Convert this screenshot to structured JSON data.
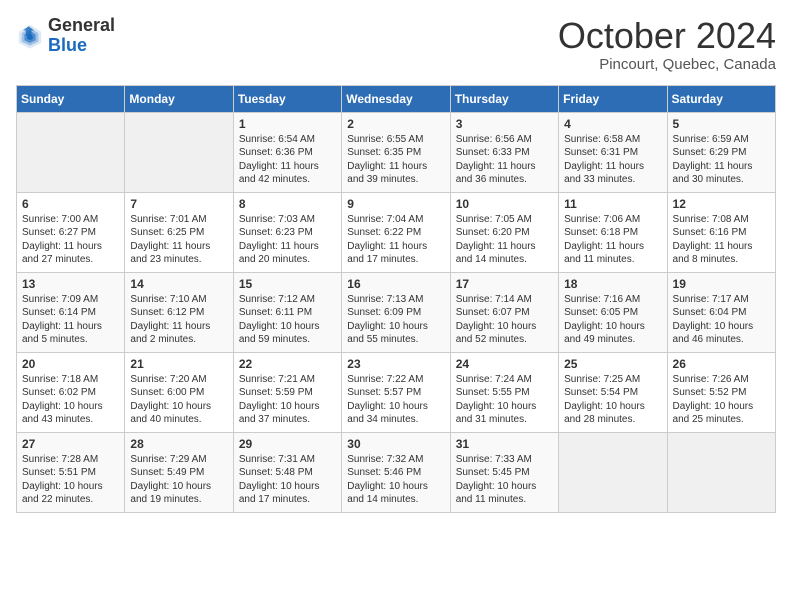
{
  "header": {
    "logo_line1": "General",
    "logo_line2": "Blue",
    "month": "October 2024",
    "location": "Pincourt, Quebec, Canada"
  },
  "weekdays": [
    "Sunday",
    "Monday",
    "Tuesday",
    "Wednesday",
    "Thursday",
    "Friday",
    "Saturday"
  ],
  "weeks": [
    [
      {
        "day": "",
        "sunrise": "",
        "sunset": "",
        "daylight": ""
      },
      {
        "day": "",
        "sunrise": "",
        "sunset": "",
        "daylight": ""
      },
      {
        "day": "1",
        "sunrise": "Sunrise: 6:54 AM",
        "sunset": "Sunset: 6:36 PM",
        "daylight": "Daylight: 11 hours and 42 minutes."
      },
      {
        "day": "2",
        "sunrise": "Sunrise: 6:55 AM",
        "sunset": "Sunset: 6:35 PM",
        "daylight": "Daylight: 11 hours and 39 minutes."
      },
      {
        "day": "3",
        "sunrise": "Sunrise: 6:56 AM",
        "sunset": "Sunset: 6:33 PM",
        "daylight": "Daylight: 11 hours and 36 minutes."
      },
      {
        "day": "4",
        "sunrise": "Sunrise: 6:58 AM",
        "sunset": "Sunset: 6:31 PM",
        "daylight": "Daylight: 11 hours and 33 minutes."
      },
      {
        "day": "5",
        "sunrise": "Sunrise: 6:59 AM",
        "sunset": "Sunset: 6:29 PM",
        "daylight": "Daylight: 11 hours and 30 minutes."
      }
    ],
    [
      {
        "day": "6",
        "sunrise": "Sunrise: 7:00 AM",
        "sunset": "Sunset: 6:27 PM",
        "daylight": "Daylight: 11 hours and 27 minutes."
      },
      {
        "day": "7",
        "sunrise": "Sunrise: 7:01 AM",
        "sunset": "Sunset: 6:25 PM",
        "daylight": "Daylight: 11 hours and 23 minutes."
      },
      {
        "day": "8",
        "sunrise": "Sunrise: 7:03 AM",
        "sunset": "Sunset: 6:23 PM",
        "daylight": "Daylight: 11 hours and 20 minutes."
      },
      {
        "day": "9",
        "sunrise": "Sunrise: 7:04 AM",
        "sunset": "Sunset: 6:22 PM",
        "daylight": "Daylight: 11 hours and 17 minutes."
      },
      {
        "day": "10",
        "sunrise": "Sunrise: 7:05 AM",
        "sunset": "Sunset: 6:20 PM",
        "daylight": "Daylight: 11 hours and 14 minutes."
      },
      {
        "day": "11",
        "sunrise": "Sunrise: 7:06 AM",
        "sunset": "Sunset: 6:18 PM",
        "daylight": "Daylight: 11 hours and 11 minutes."
      },
      {
        "day": "12",
        "sunrise": "Sunrise: 7:08 AM",
        "sunset": "Sunset: 6:16 PM",
        "daylight": "Daylight: 11 hours and 8 minutes."
      }
    ],
    [
      {
        "day": "13",
        "sunrise": "Sunrise: 7:09 AM",
        "sunset": "Sunset: 6:14 PM",
        "daylight": "Daylight: 11 hours and 5 minutes."
      },
      {
        "day": "14",
        "sunrise": "Sunrise: 7:10 AM",
        "sunset": "Sunset: 6:12 PM",
        "daylight": "Daylight: 11 hours and 2 minutes."
      },
      {
        "day": "15",
        "sunrise": "Sunrise: 7:12 AM",
        "sunset": "Sunset: 6:11 PM",
        "daylight": "Daylight: 10 hours and 59 minutes."
      },
      {
        "day": "16",
        "sunrise": "Sunrise: 7:13 AM",
        "sunset": "Sunset: 6:09 PM",
        "daylight": "Daylight: 10 hours and 55 minutes."
      },
      {
        "day": "17",
        "sunrise": "Sunrise: 7:14 AM",
        "sunset": "Sunset: 6:07 PM",
        "daylight": "Daylight: 10 hours and 52 minutes."
      },
      {
        "day": "18",
        "sunrise": "Sunrise: 7:16 AM",
        "sunset": "Sunset: 6:05 PM",
        "daylight": "Daylight: 10 hours and 49 minutes."
      },
      {
        "day": "19",
        "sunrise": "Sunrise: 7:17 AM",
        "sunset": "Sunset: 6:04 PM",
        "daylight": "Daylight: 10 hours and 46 minutes."
      }
    ],
    [
      {
        "day": "20",
        "sunrise": "Sunrise: 7:18 AM",
        "sunset": "Sunset: 6:02 PM",
        "daylight": "Daylight: 10 hours and 43 minutes."
      },
      {
        "day": "21",
        "sunrise": "Sunrise: 7:20 AM",
        "sunset": "Sunset: 6:00 PM",
        "daylight": "Daylight: 10 hours and 40 minutes."
      },
      {
        "day": "22",
        "sunrise": "Sunrise: 7:21 AM",
        "sunset": "Sunset: 5:59 PM",
        "daylight": "Daylight: 10 hours and 37 minutes."
      },
      {
        "day": "23",
        "sunrise": "Sunrise: 7:22 AM",
        "sunset": "Sunset: 5:57 PM",
        "daylight": "Daylight: 10 hours and 34 minutes."
      },
      {
        "day": "24",
        "sunrise": "Sunrise: 7:24 AM",
        "sunset": "Sunset: 5:55 PM",
        "daylight": "Daylight: 10 hours and 31 minutes."
      },
      {
        "day": "25",
        "sunrise": "Sunrise: 7:25 AM",
        "sunset": "Sunset: 5:54 PM",
        "daylight": "Daylight: 10 hours and 28 minutes."
      },
      {
        "day": "26",
        "sunrise": "Sunrise: 7:26 AM",
        "sunset": "Sunset: 5:52 PM",
        "daylight": "Daylight: 10 hours and 25 minutes."
      }
    ],
    [
      {
        "day": "27",
        "sunrise": "Sunrise: 7:28 AM",
        "sunset": "Sunset: 5:51 PM",
        "daylight": "Daylight: 10 hours and 22 minutes."
      },
      {
        "day": "28",
        "sunrise": "Sunrise: 7:29 AM",
        "sunset": "Sunset: 5:49 PM",
        "daylight": "Daylight: 10 hours and 19 minutes."
      },
      {
        "day": "29",
        "sunrise": "Sunrise: 7:31 AM",
        "sunset": "Sunset: 5:48 PM",
        "daylight": "Daylight: 10 hours and 17 minutes."
      },
      {
        "day": "30",
        "sunrise": "Sunrise: 7:32 AM",
        "sunset": "Sunset: 5:46 PM",
        "daylight": "Daylight: 10 hours and 14 minutes."
      },
      {
        "day": "31",
        "sunrise": "Sunrise: 7:33 AM",
        "sunset": "Sunset: 5:45 PM",
        "daylight": "Daylight: 10 hours and 11 minutes."
      },
      {
        "day": "",
        "sunrise": "",
        "sunset": "",
        "daylight": ""
      },
      {
        "day": "",
        "sunrise": "",
        "sunset": "",
        "daylight": ""
      }
    ]
  ]
}
